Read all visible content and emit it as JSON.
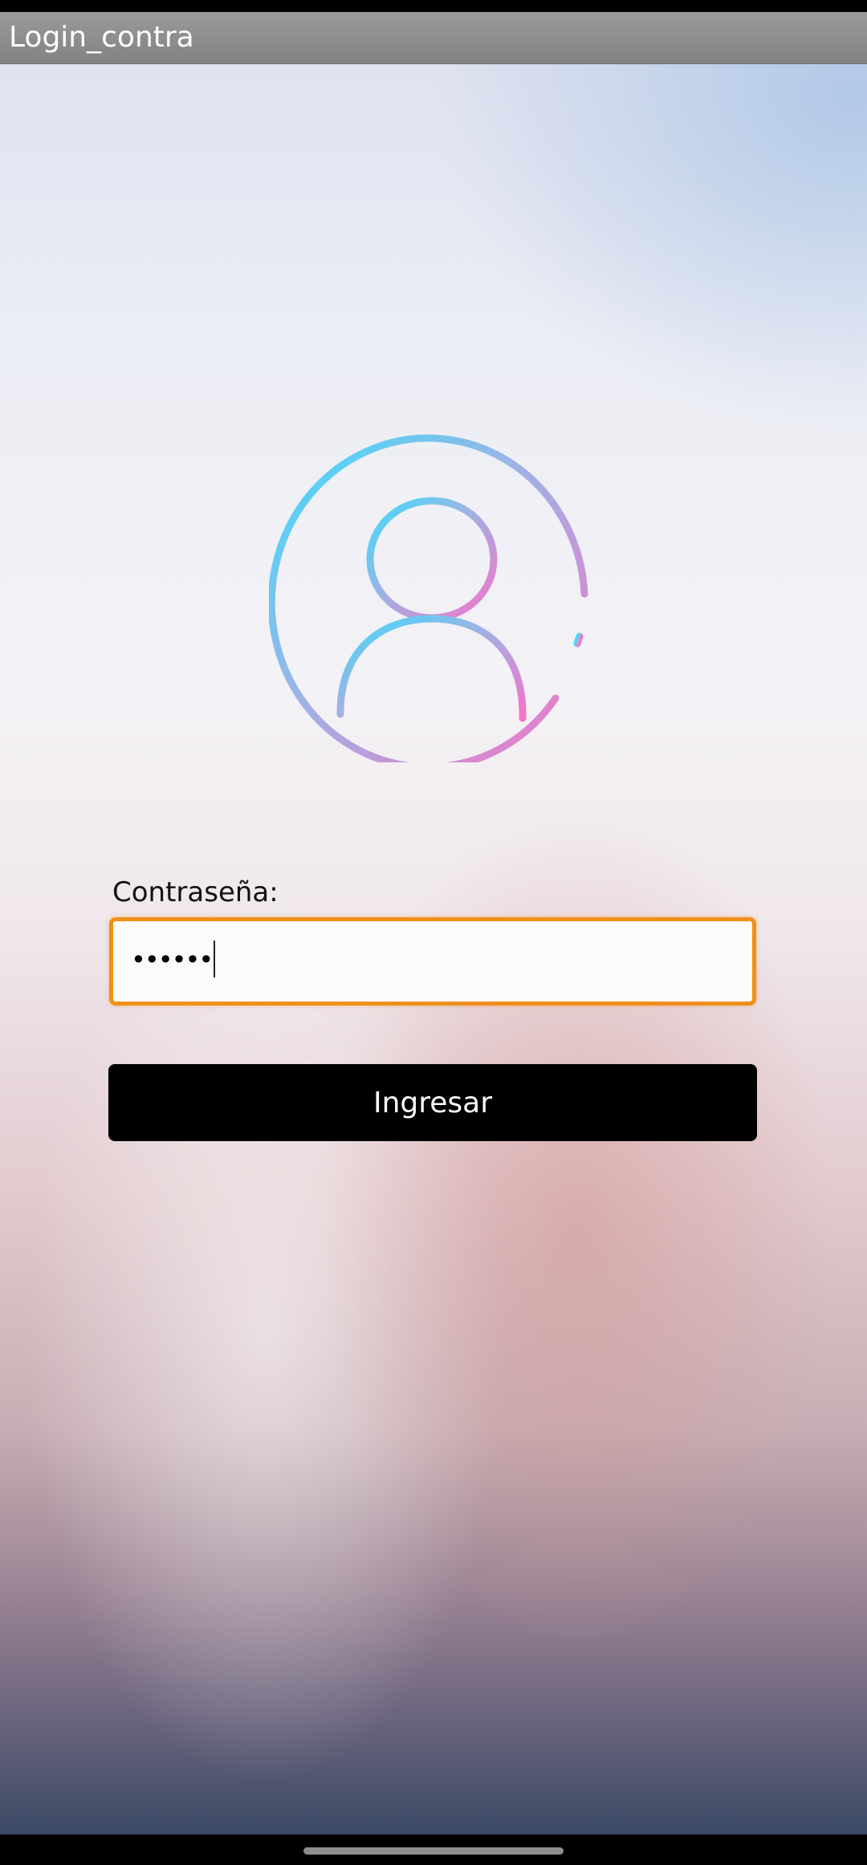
{
  "app": {
    "title": "Login_contra"
  },
  "login": {
    "avatar_icon": "user-circle-icon",
    "password_label": "Contraseña:",
    "password_value": "••••••",
    "submit_label": "Ingresar"
  },
  "colors": {
    "title_bar": "#8c8c8c",
    "input_focus_border": "#f08f1c",
    "button_background": "#000000",
    "avatar_gradient_start": "#3fdcfb",
    "avatar_gradient_end": "#f573c8"
  }
}
